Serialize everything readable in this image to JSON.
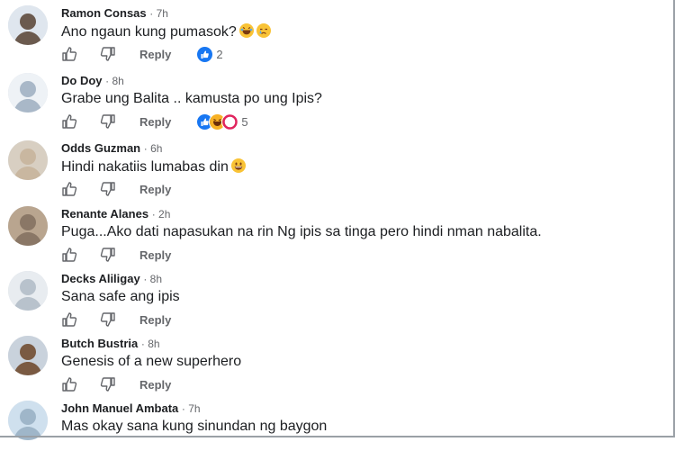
{
  "comments": [
    {
      "name": "Ramon Consas",
      "time": "· 7h",
      "text": "Ano ngaun kung pumasok?",
      "emojis": [
        "laughing-face-emoji",
        "tearful-face-emoji"
      ],
      "reply_label": "Reply",
      "reaction_icons": [
        "like-reaction-icon"
      ],
      "reaction_count": "2",
      "avatar_color": "#6b5a4e"
    },
    {
      "name": "Do Doy",
      "time": "· 8h",
      "text": "Grabe ung Balita .. kamusta po ung Ipis?",
      "emojis": [],
      "reply_label": "Reply",
      "reaction_icons": [
        "like-reaction-icon",
        "haha-reaction-icon"
      ],
      "reaction_count": "5",
      "avatar_color": "#a9b8c8"
    },
    {
      "name": "Odds Guzman",
      "time": "· 6h",
      "text": "Hindi nakatiis lumabas din",
      "emojis": [
        "grinning-face-emoji"
      ],
      "reply_label": "Reply",
      "reaction_icons": [],
      "reaction_count": "",
      "avatar_color": "#c9b7a0"
    },
    {
      "name": "Renante Alanes",
      "time": "· 2h",
      "text": "Puga...Ako dati napasukan na rin Ng ipis sa tinga pero hindi nman nabalita.",
      "emojis": [],
      "reply_label": "Reply",
      "reaction_icons": [],
      "reaction_count": "",
      "avatar_color": "#8a7766"
    },
    {
      "name": "Decks Aliligay",
      "time": "· 8h",
      "text": "Sana safe ang ipis",
      "emojis": [],
      "reply_label": "Reply",
      "reaction_icons": [],
      "reaction_count": "",
      "avatar_color": "#b8c2cc"
    },
    {
      "name": "Butch Bustria",
      "time": "· 8h",
      "text": "Genesis of a new superhero",
      "emojis": [],
      "reply_label": "Reply",
      "reaction_icons": [],
      "reaction_count": "",
      "avatar_color": "#7a5a42"
    },
    {
      "name": "John Manuel Ambata",
      "time": "· 7h",
      "text": "Mas okay sana kung sinundan ng baygon",
      "emojis": [],
      "reply_label": "",
      "reaction_icons": [],
      "reaction_count": "",
      "avatar_color": "#9fb6c9"
    }
  ],
  "colors": {
    "like_blue": "#1877f2",
    "haha_yellow": "#f7b125",
    "muted_text": "#65676b"
  }
}
